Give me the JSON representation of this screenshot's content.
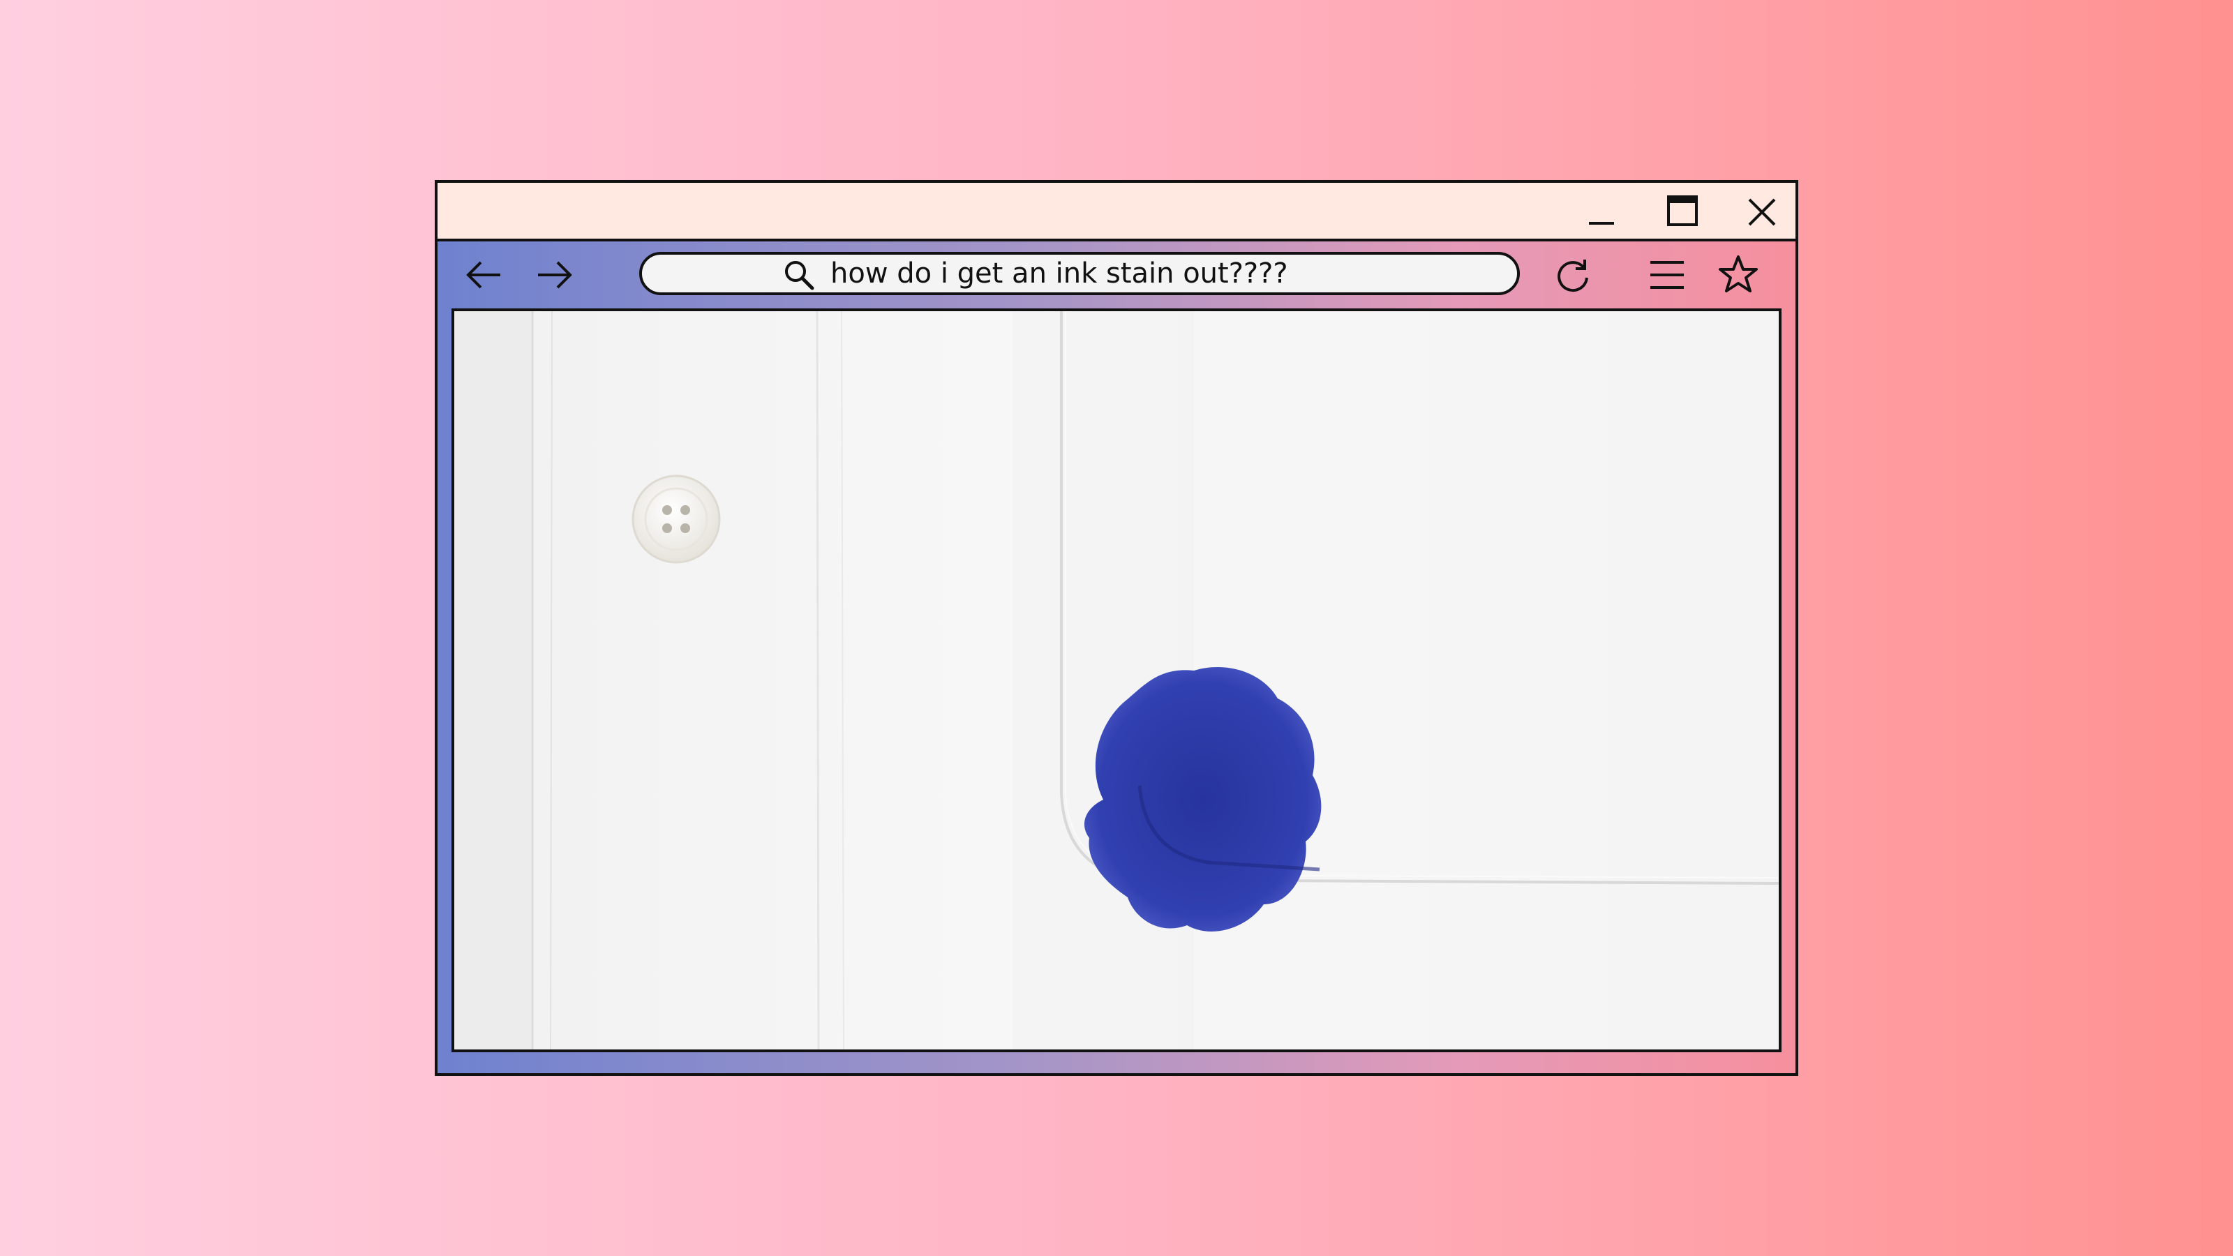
{
  "window": {
    "controls": {
      "minimize_icon": "minimize-icon",
      "maximize_icon": "maximize-icon",
      "close_icon": "close-icon"
    }
  },
  "toolbar": {
    "back_icon": "arrow-left-icon",
    "forward_icon": "arrow-right-icon",
    "refresh_icon": "refresh-icon",
    "menu_icon": "hamburger-menu-icon",
    "bookmark_icon": "star-icon"
  },
  "address_bar": {
    "search_icon": "magnifier-icon",
    "value": "how do i get an ink stain out????"
  },
  "colors": {
    "background_left": "#ffcfe0",
    "background_right": "#ff9190",
    "titlebar": "#ffe9e0",
    "frame_left": "#6f82cf",
    "frame_right": "#f6909e",
    "ink_stain": "#2b3aa8"
  }
}
